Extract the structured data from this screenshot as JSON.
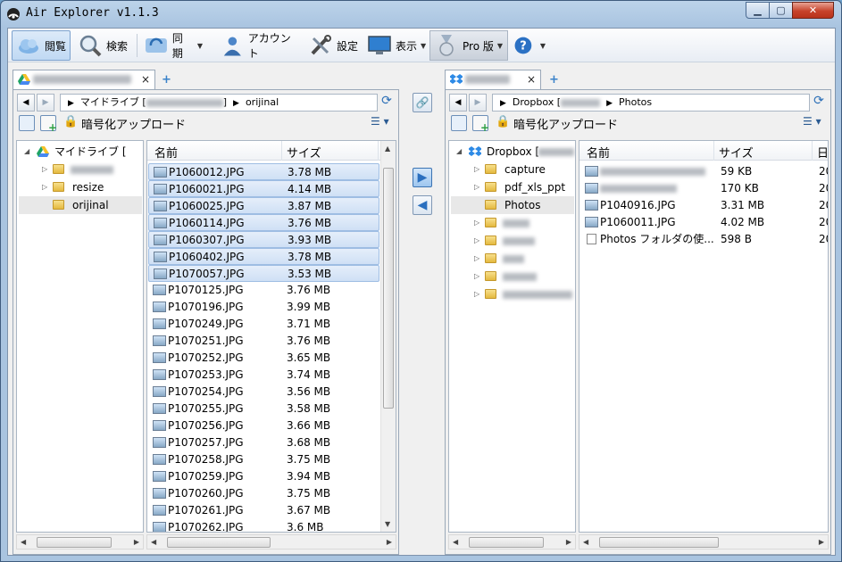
{
  "window": {
    "title": "Air Explorer v1.1.3",
    "min": "▁",
    "max": "▢",
    "close": "✕"
  },
  "toolbar": {
    "browse": "閲覧",
    "search": "検索",
    "sync": "同期",
    "account": "アカウント",
    "settings": "設定",
    "view": "表示",
    "pro": "Pro 版",
    "help_caret": "▾"
  },
  "left": {
    "tab_close": "×",
    "breadcrumb_root": "マイドライブ [",
    "breadcrumb_close": "]",
    "breadcrumb_folder": "orijinal",
    "encrypt_upload": "暗号化アップロード",
    "tree": {
      "root": "マイドライブ [",
      "items": [
        "resize",
        "orijinal"
      ]
    },
    "columns": {
      "name": "名前",
      "size": "サイズ"
    },
    "files": [
      {
        "name": "P1060012.JPG",
        "size": "3.78 MB",
        "selected": true
      },
      {
        "name": "P1060021.JPG",
        "size": "4.14 MB",
        "selected": true
      },
      {
        "name": "P1060025.JPG",
        "size": "3.87 MB",
        "selected": true
      },
      {
        "name": "P1060114.JPG",
        "size": "3.76 MB",
        "selected": true
      },
      {
        "name": "P1060307.JPG",
        "size": "3.93 MB",
        "selected": true
      },
      {
        "name": "P1060402.JPG",
        "size": "3.78 MB",
        "selected": true
      },
      {
        "name": "P1070057.JPG",
        "size": "3.53 MB",
        "selected": true
      },
      {
        "name": "P1070125.JPG",
        "size": "3.76 MB",
        "selected": false
      },
      {
        "name": "P1070196.JPG",
        "size": "3.99 MB",
        "selected": false
      },
      {
        "name": "P1070249.JPG",
        "size": "3.71 MB",
        "selected": false
      },
      {
        "name": "P1070251.JPG",
        "size": "3.76 MB",
        "selected": false
      },
      {
        "name": "P1070252.JPG",
        "size": "3.65 MB",
        "selected": false
      },
      {
        "name": "P1070253.JPG",
        "size": "3.74 MB",
        "selected": false
      },
      {
        "name": "P1070254.JPG",
        "size": "3.56 MB",
        "selected": false
      },
      {
        "name": "P1070255.JPG",
        "size": "3.58 MB",
        "selected": false
      },
      {
        "name": "P1070256.JPG",
        "size": "3.66 MB",
        "selected": false
      },
      {
        "name": "P1070257.JPG",
        "size": "3.68 MB",
        "selected": false
      },
      {
        "name": "P1070258.JPG",
        "size": "3.75 MB",
        "selected": false
      },
      {
        "name": "P1070259.JPG",
        "size": "3.94 MB",
        "selected": false
      },
      {
        "name": "P1070260.JPG",
        "size": "3.75 MB",
        "selected": false
      },
      {
        "name": "P1070261.JPG",
        "size": "3.67 MB",
        "selected": false
      },
      {
        "name": "P1070262.JPG",
        "size": "3.6 MB",
        "selected": false
      }
    ]
  },
  "right": {
    "tab_close": "×",
    "breadcrumb_root": "Dropbox [",
    "breadcrumb_folder": "Photos",
    "encrypt_upload": "暗号化アップロード",
    "tree": {
      "root": "Dropbox [",
      "items": [
        "capture",
        "pdf_xls_ppt",
        "Photos"
      ]
    },
    "columns": {
      "name": "名前",
      "size": "サイズ",
      "date": "日..."
    },
    "files": [
      {
        "name": "",
        "size": "59 KB",
        "date": "20",
        "blurred": true,
        "icon": "image"
      },
      {
        "name": "",
        "size": "170 KB",
        "date": "20",
        "blurred": true,
        "icon": "image"
      },
      {
        "name": "P1040916.JPG",
        "size": "3.31 MB",
        "date": "20",
        "blurred": false,
        "icon": "image"
      },
      {
        "name": "P1060011.JPG",
        "size": "4.02 MB",
        "date": "20",
        "blurred": false,
        "icon": "image"
      },
      {
        "name": "Photos フォルダの使...",
        "size": "598 B",
        "date": "20",
        "blurred": false,
        "icon": "doc"
      }
    ]
  },
  "colors": {
    "accent": "#2a6fbf",
    "selection": "#cfe0f5",
    "titlebar": "#a9c4e0"
  }
}
